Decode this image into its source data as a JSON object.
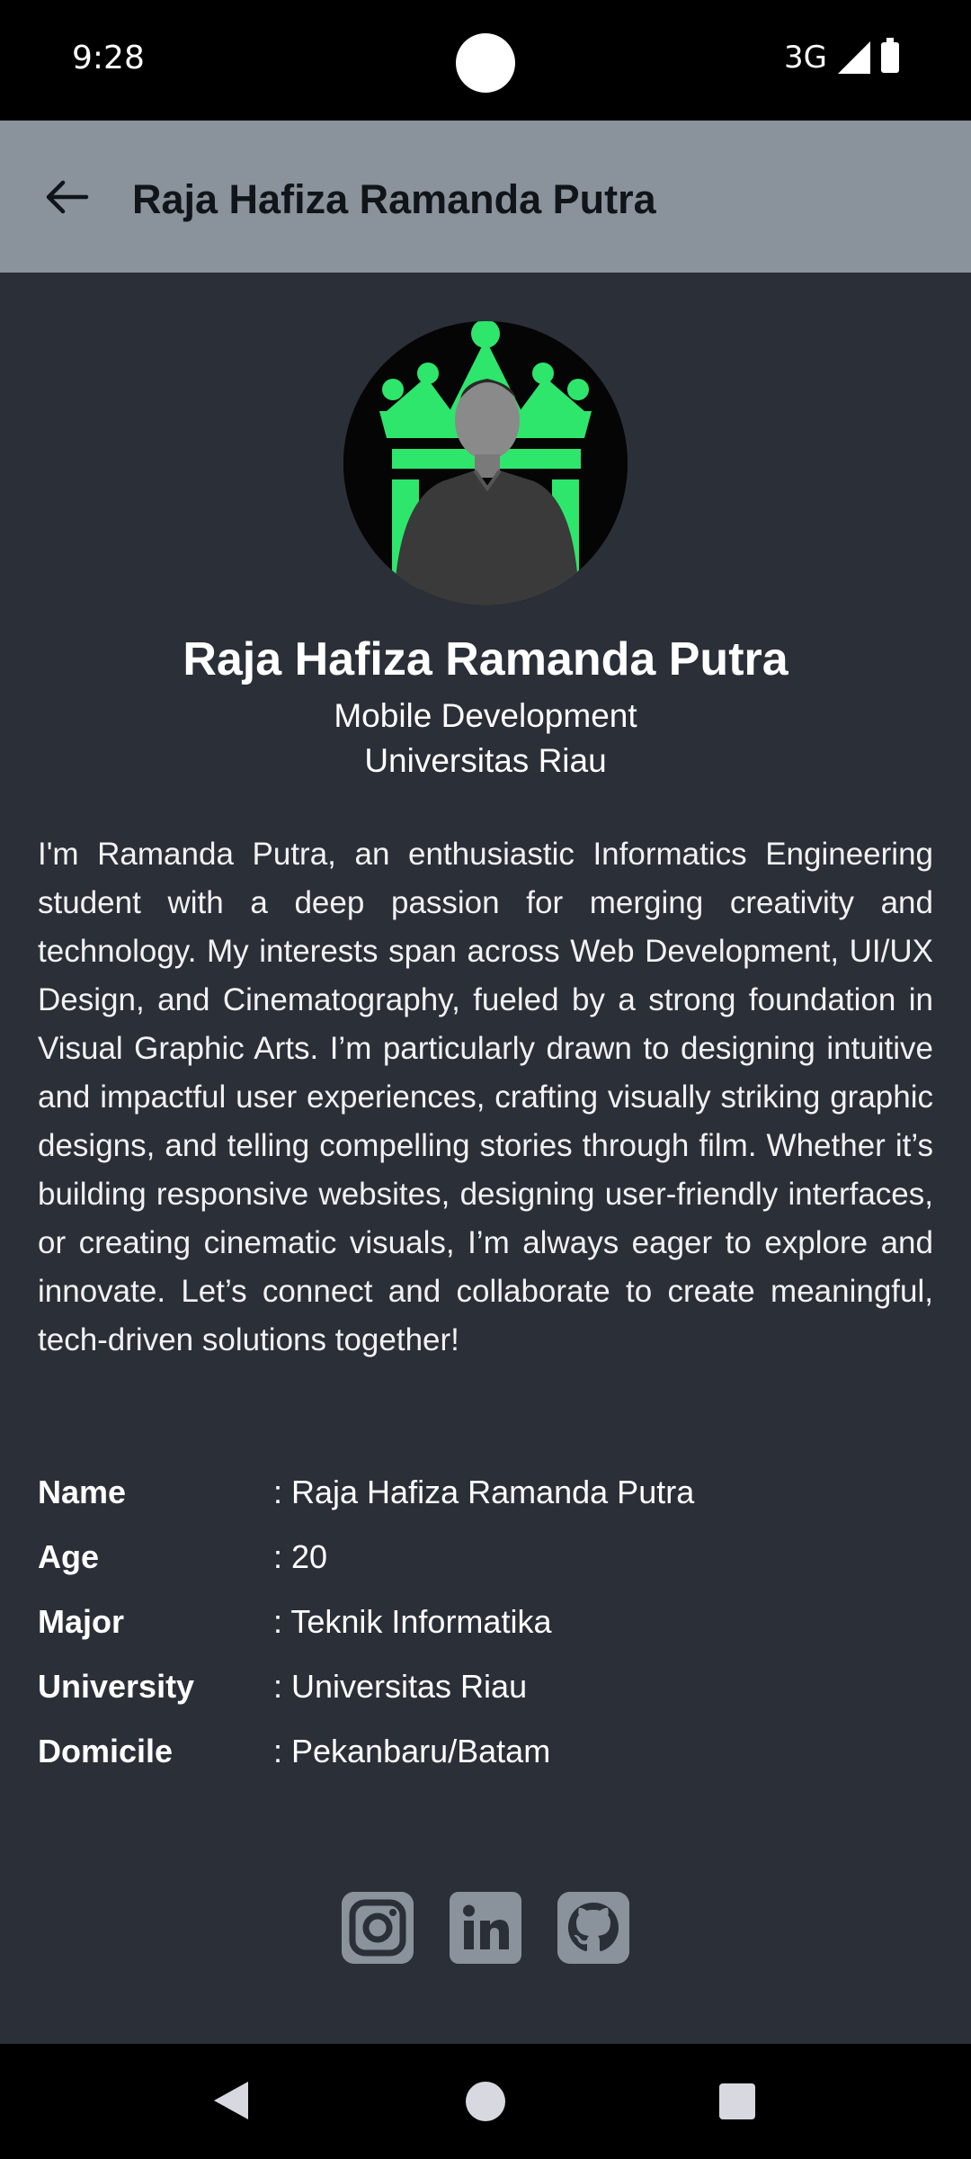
{
  "status_bar": {
    "time": "9:28",
    "network": "3G"
  },
  "app_bar": {
    "title": "Raja Hafiza Ramanda Putra"
  },
  "profile": {
    "name": "Raja Hafiza Ramanda Putra",
    "role": "Mobile Development",
    "university": "Universitas Riau",
    "bio": "I'm Ramanda Putra, an enthusiastic Informatics Engineering student with a deep passion for merging creativity and technology. My interests span across Web Development, UI/UX Design, and Cinematography, fueled by a strong foundation in Visual Graphic Arts. I’m particularly drawn to designing intuitive and impactful user experiences, crafting visually striking graphic designs, and telling compelling stories through film. Whether it’s building responsive websites, designing user-friendly interfaces, or creating cinematic visuals, I’m always eager to explore and innovate. Let’s connect and collaborate to create meaningful, tech-driven solutions together!"
  },
  "details": [
    {
      "label": "Name",
      "value": ": Raja Hafiza Ramanda Putra"
    },
    {
      "label": "Age",
      "value": ": 20"
    },
    {
      "label": "Major",
      "value": ": Teknik Informatika"
    },
    {
      "label": "University",
      "value": ": Universitas Riau"
    },
    {
      "label": "Domicile",
      "value": ": Pekanbaru/Batam"
    }
  ],
  "socials": [
    "instagram-icon",
    "linkedin-icon",
    "github-icon"
  ],
  "colors": {
    "app_bar": "#8a929b",
    "background": "#2b2f38",
    "avatar_accent": "#2ee66b"
  }
}
